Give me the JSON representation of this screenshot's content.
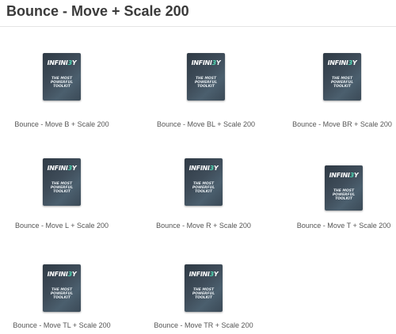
{
  "page": {
    "title": "Bounce - Move + Scale 200"
  },
  "thumbnail": {
    "logo_main": "INFINI",
    "logo_accent": "3",
    "logo_end": "Y",
    "tagline_line1": "THE MOST",
    "tagline_line2": "POWERFUL",
    "tagline_line3": "TOOLKIT",
    "accent_color": "#4fd3b0"
  },
  "gallery": {
    "items": [
      {
        "caption": "Bounce - Move B + Scale 200"
      },
      {
        "caption": "Bounce - Move BL + Scale 200"
      },
      {
        "caption": "Bounce - Move BR + Scale 200"
      },
      {
        "caption": "Bounce - Move L + Scale 200"
      },
      {
        "caption": "Bounce - Move R + Scale 200"
      },
      {
        "caption": "Bounce - Move T + Scale 200"
      },
      {
        "caption": "Bounce - Move TL + Scale 200"
      },
      {
        "caption": "Bounce - Move TR + Scale 200"
      }
    ]
  }
}
